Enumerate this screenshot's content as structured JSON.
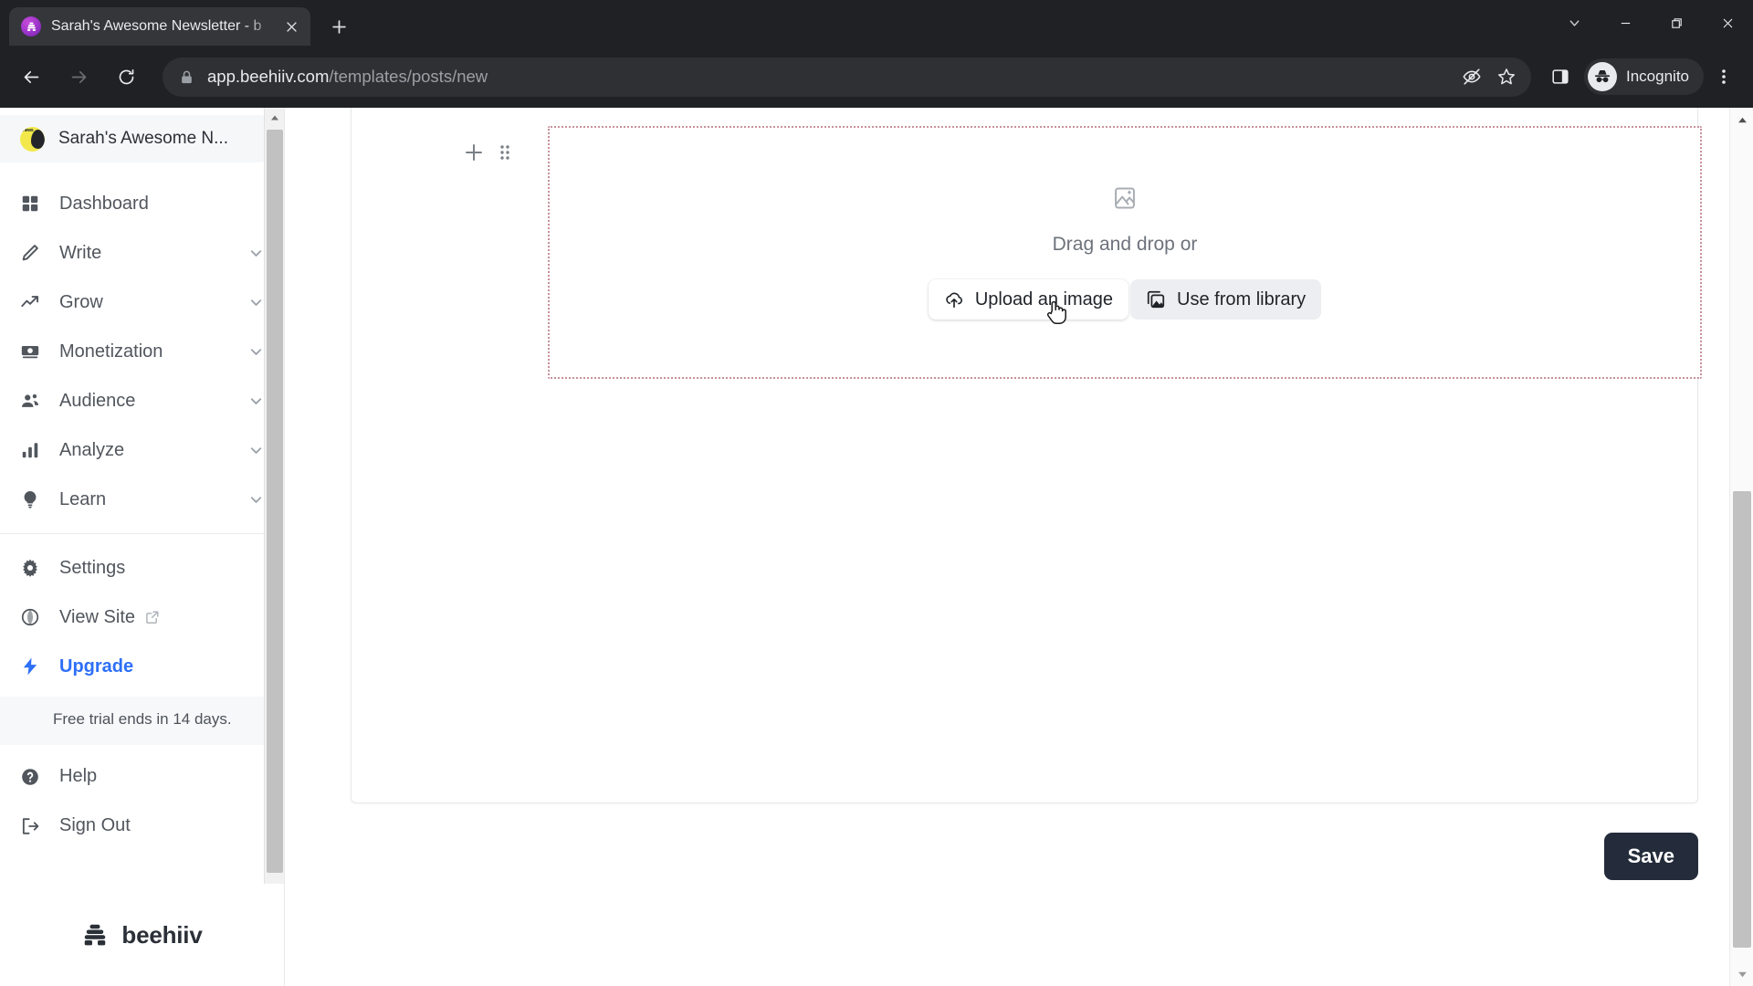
{
  "browser": {
    "tab": {
      "title": "Sarah's Awesome Newsletter - b",
      "favicon": "beehiiv-hive-icon",
      "close_icon": "close-icon"
    },
    "new_tab_icon": "plus-icon",
    "window_controls": [
      {
        "name": "chevron-down-icon",
        "label": ""
      },
      {
        "name": "minimize-icon",
        "label": ""
      },
      {
        "name": "maximize-restore-icon",
        "label": ""
      },
      {
        "name": "close-window-icon",
        "label": ""
      }
    ],
    "nav": {
      "back_icon": "back-arrow-icon",
      "forward_icon": "forward-arrow-icon",
      "reload_icon": "reload-icon"
    },
    "omnibox": {
      "lock_icon": "lock-icon",
      "url_host": "app.beehiiv.com",
      "url_path": "/templates/posts/new",
      "url_full": "app.beehiiv.com/templates/posts/new",
      "third_party_cookie_icon": "eye-slash-icon",
      "bookmark_icon": "star-icon"
    },
    "toolbar": {
      "side_panel_icon": "side-panel-icon",
      "profile_icon": "incognito-icon",
      "profile_label": "Incognito",
      "menu_icon": "three-dot-menu-icon"
    }
  },
  "sidebar": {
    "workspace": {
      "name": "Sarah's Awesome N...",
      "logo_icon": "workspace-avatar",
      "logo_badge_text": "news"
    },
    "nav_items": [
      {
        "label": "Dashboard",
        "icon": "grid-icon",
        "expandable": false
      },
      {
        "label": "Write",
        "icon": "pencil-icon",
        "expandable": true
      },
      {
        "label": "Grow",
        "icon": "trend-up-icon",
        "expandable": true
      },
      {
        "label": "Monetization",
        "icon": "money-icon",
        "expandable": true
      },
      {
        "label": "Audience",
        "icon": "people-icon",
        "expandable": true
      },
      {
        "label": "Analyze",
        "icon": "bar-chart-icon",
        "expandable": true
      },
      {
        "label": "Learn",
        "icon": "lightbulb-icon",
        "expandable": true
      }
    ],
    "footer_items": [
      {
        "label": "Settings",
        "icon": "gear-icon",
        "external": false
      },
      {
        "label": "View Site",
        "icon": "globe-icon",
        "external": true
      },
      {
        "label": "Upgrade",
        "icon": "lightning-bolt-icon",
        "external": false
      }
    ],
    "trial_notice": "Free trial ends in 14 days.",
    "help_items": [
      {
        "label": "Help",
        "icon": "question-circle-icon"
      },
      {
        "label": "Sign Out",
        "icon": "sign-out-icon"
      }
    ],
    "brand": {
      "wordmark": "beehiiv",
      "logo_icon": "beehiiv-hive-icon"
    }
  },
  "editor": {
    "block_tools": {
      "add_icon": "plus-icon",
      "drag_handle_icon": "drag-handle-icon"
    },
    "dropzone": {
      "image_icon": "image-placeholder-icon",
      "prompt": "Drag and drop or",
      "buttons": [
        {
          "label": "Upload an image",
          "icon": "upload-cloud-icon",
          "state": "normal"
        },
        {
          "label": "Use from library",
          "icon": "image-library-icon",
          "state": "hovered"
        }
      ],
      "border_color": "#c8919c"
    },
    "save_button": {
      "label": "Save",
      "color": "#242c3b"
    }
  },
  "colors": {
    "accent_blue": "#2d6ff7",
    "chrome_dark": "#202124",
    "dropzone_border": "#c8919c",
    "save_bg": "#242c3b"
  }
}
